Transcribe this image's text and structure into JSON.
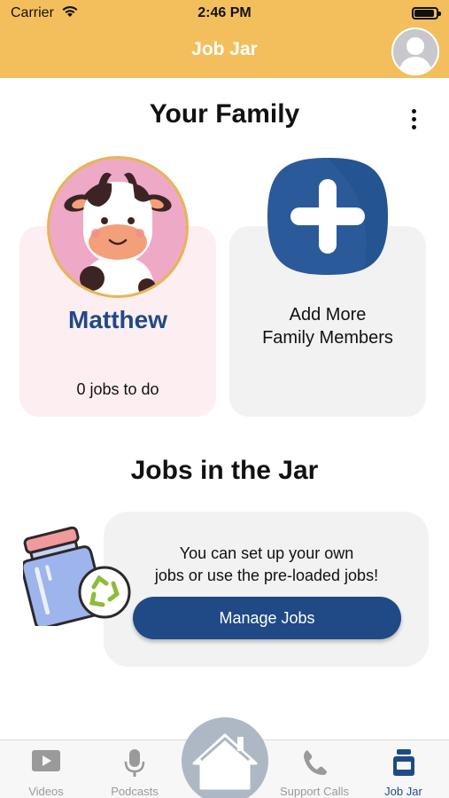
{
  "status_bar": {
    "carrier": "Carrier",
    "time": "2:46 PM"
  },
  "header": {
    "title": "Job Jar",
    "background": "#f3bf5c"
  },
  "family": {
    "title": "Your Family",
    "members": [
      {
        "name": "Matthew",
        "jobs_text": "0 jobs to do",
        "avatar_icon": "cow-avatar"
      }
    ],
    "add_member_line1": "Add More",
    "add_member_line2": "Family Members"
  },
  "jobs_jar": {
    "title": "Jobs in the Jar",
    "description_line1": "You can set up your own",
    "description_line2": "jobs or use the pre-loaded jobs!",
    "manage_button": "Manage Jobs"
  },
  "tabs": [
    {
      "label": "Videos",
      "icon": "video-icon",
      "active": false
    },
    {
      "label": "Podcasts",
      "icon": "microphone-icon",
      "active": false
    },
    {
      "label": "Home",
      "icon": "home-icon",
      "active": false
    },
    {
      "label": "Support Calls",
      "icon": "phone-icon",
      "active": false
    },
    {
      "label": "Job Jar",
      "icon": "jar-icon",
      "active": true
    }
  ],
  "colors": {
    "accent_blue": "#1f4a86",
    "header_yellow": "#f3bf5c",
    "member_card": "#fdeef1",
    "neutral_card": "#f2f2f2"
  }
}
